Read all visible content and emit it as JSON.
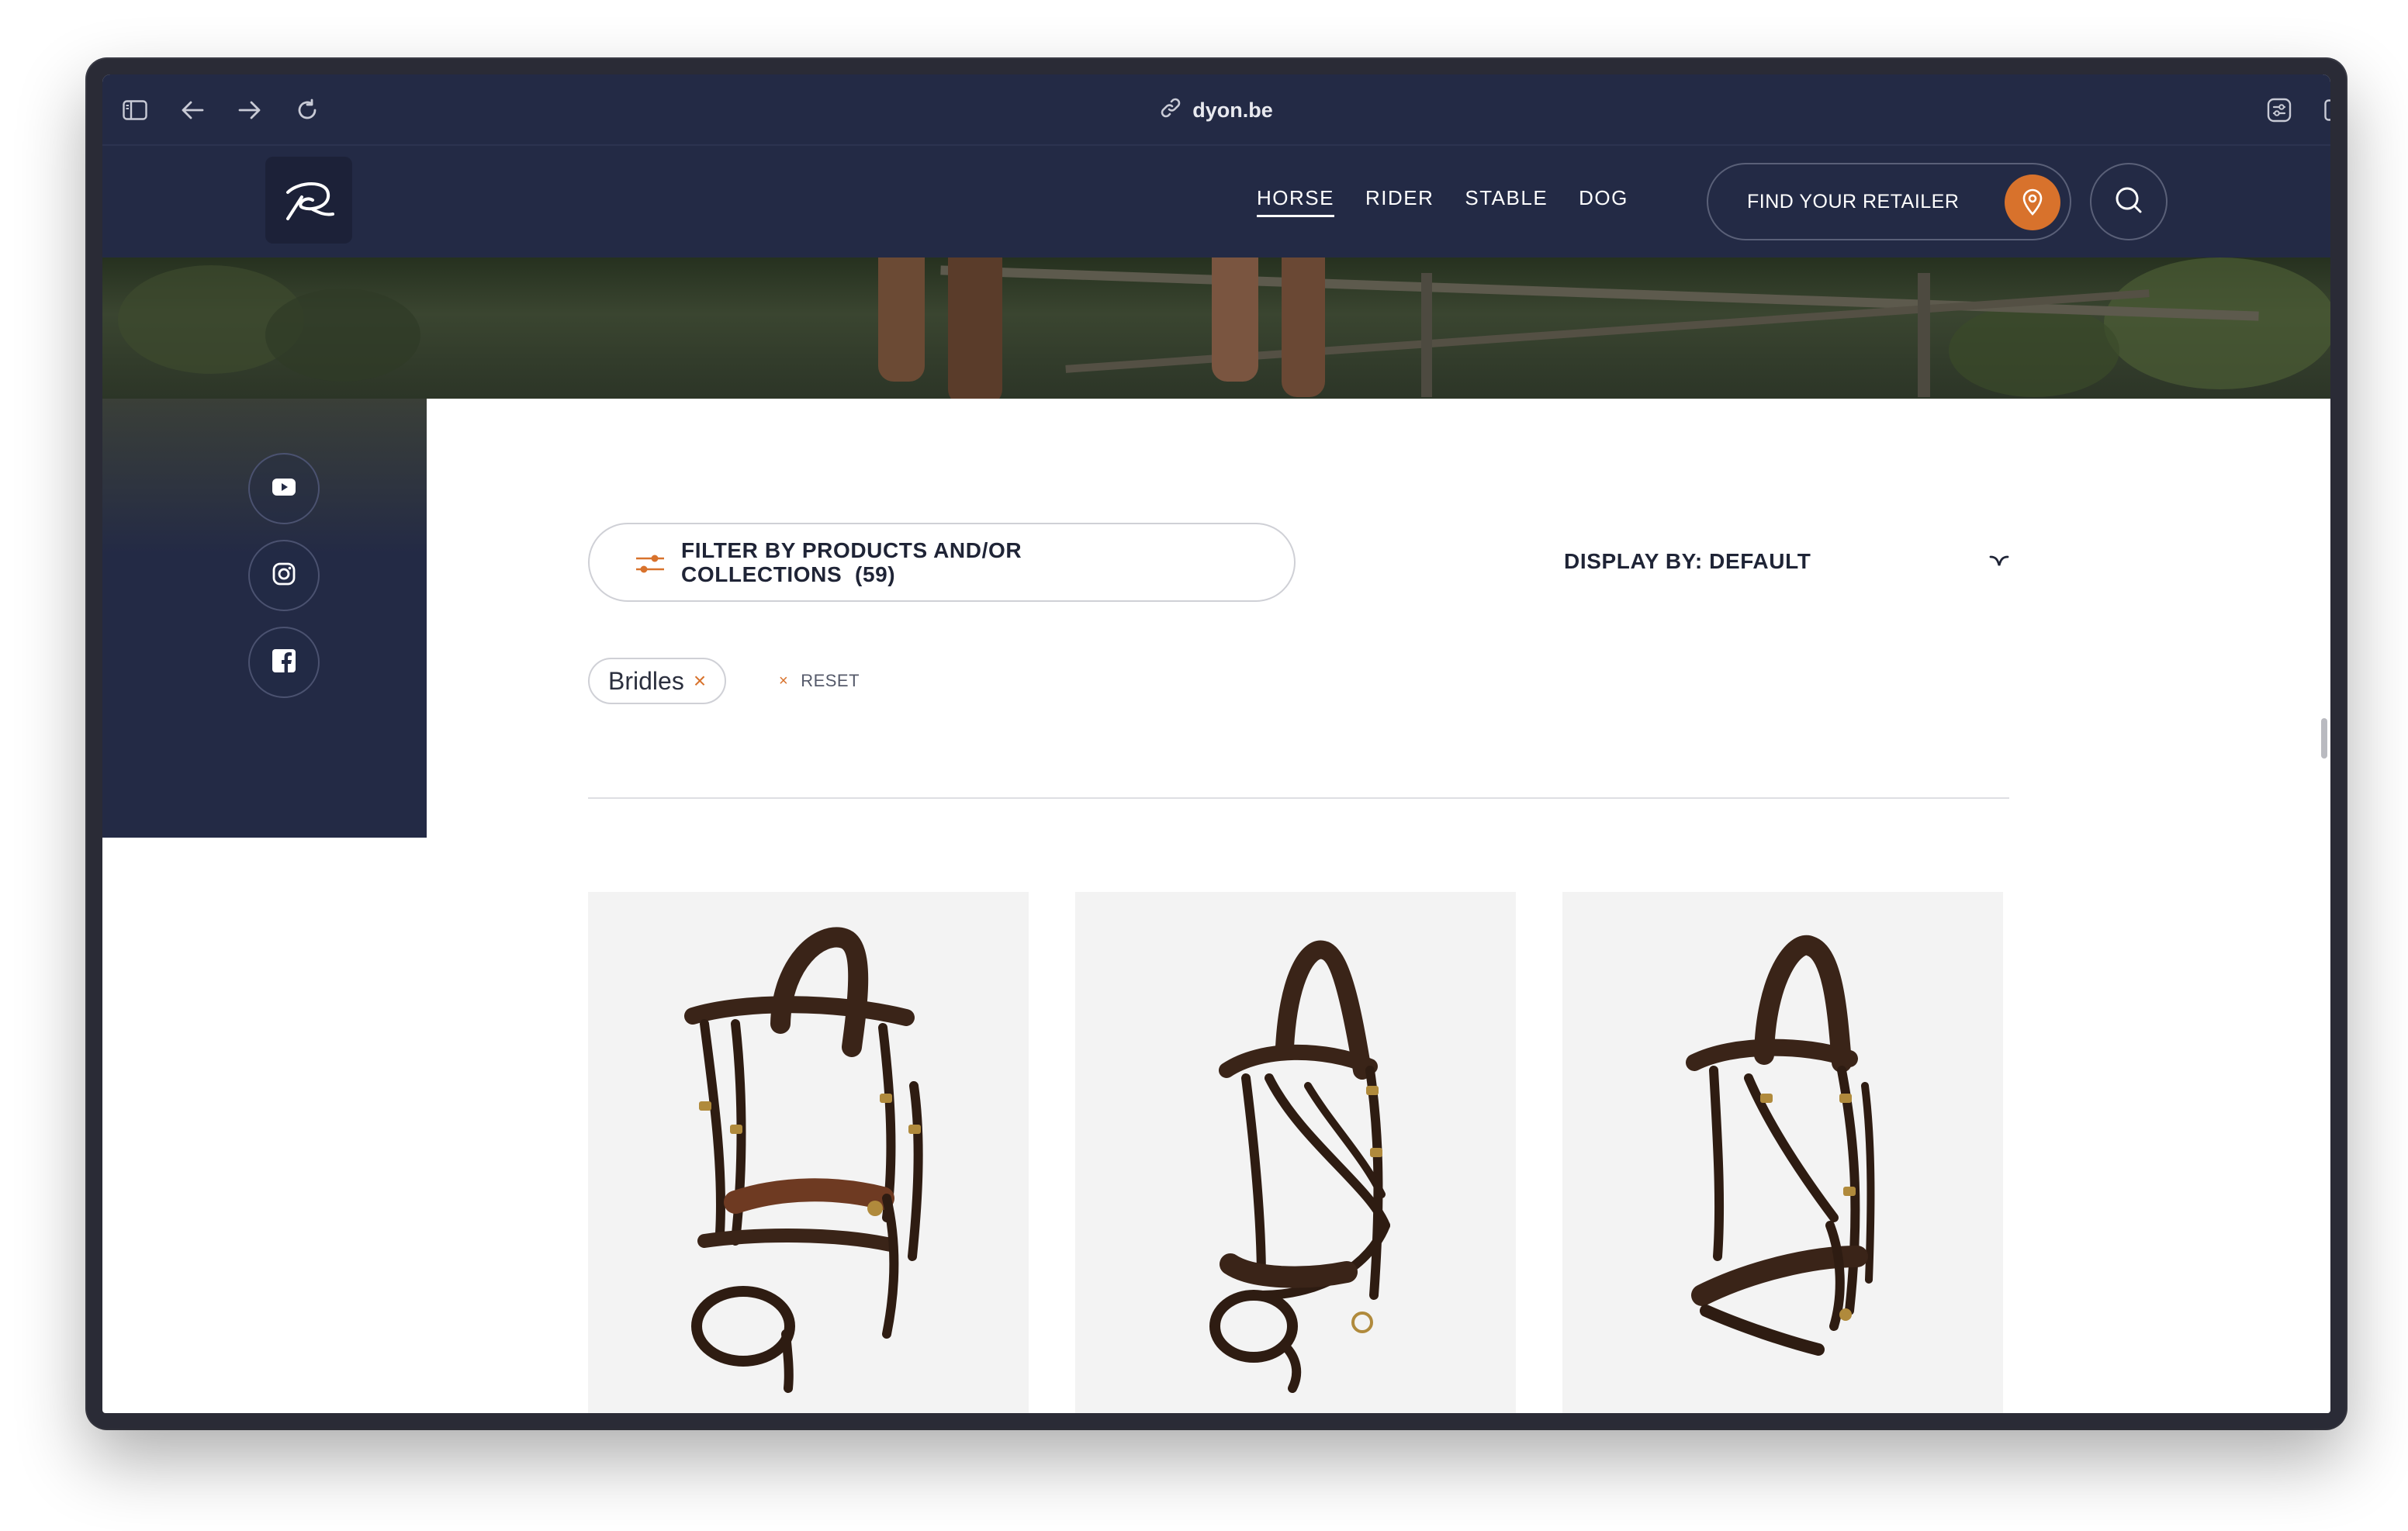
{
  "browser": {
    "url": "dyon.be",
    "icons": [
      "sidebar-icon",
      "back-icon",
      "forward-icon",
      "reload-icon",
      "extensions-icon",
      "split-view-icon"
    ]
  },
  "header": {
    "logo_icon": "dyon-logo-icon",
    "nav": [
      {
        "label": "HORSE",
        "active": true
      },
      {
        "label": "RIDER",
        "active": false
      },
      {
        "label": "STABLE",
        "active": false
      },
      {
        "label": "DOG",
        "active": false
      }
    ],
    "retailer_label": "FIND YOUR RETAILER",
    "retailer_icon": "location-pin-icon",
    "search_icon": "search-icon",
    "accent": "#d8722c",
    "bg": "#232a45"
  },
  "social": [
    {
      "name": "youtube-icon"
    },
    {
      "name": "instagram-icon"
    },
    {
      "name": "facebook-icon"
    }
  ],
  "filters": {
    "filter_label_line1": "FILTER BY PRODUCTS AND/OR",
    "filter_label_line2": "COLLECTIONS  (59)",
    "display_by_label": "DISPLAY BY: DEFAULT",
    "active_tag": "Bridles",
    "tag_remove": "×",
    "reset_label": "RESET",
    "reset_icon": "×"
  },
  "products": [
    {
      "name": "bridle-product-1"
    },
    {
      "name": "bridle-product-2"
    },
    {
      "name": "bridle-product-3"
    }
  ]
}
